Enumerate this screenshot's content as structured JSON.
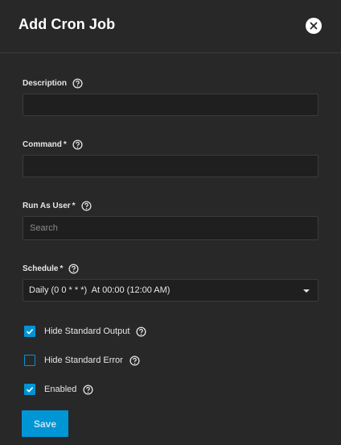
{
  "dialog": {
    "title": "Add Cron Job"
  },
  "fields": {
    "description": {
      "label": "Description",
      "required": "",
      "value": ""
    },
    "command": {
      "label": "Command",
      "required": "*",
      "value": ""
    },
    "run_as_user": {
      "label": "Run As User",
      "required": "*",
      "placeholder": "Search",
      "value": ""
    },
    "schedule": {
      "label": "Schedule",
      "required": "*",
      "value": "Daily (0 0 * * *)  At 00:00 (12:00 AM)"
    }
  },
  "options": {
    "hide_stdout": {
      "label": "Hide Standard Output",
      "checked": true
    },
    "hide_stderr": {
      "label": "Hide Standard Error",
      "checked": false
    },
    "enabled": {
      "label": "Enabled",
      "checked": true
    }
  },
  "actions": {
    "save_label": "Save"
  },
  "colors": {
    "accent": "#0095d5",
    "background": "#282828",
    "input_bg": "#1f1f1f"
  },
  "icons": {
    "close": "close-circle-icon",
    "help": "help-circle-icon",
    "check": "checkmark-icon",
    "caret": "caret-down-icon"
  }
}
